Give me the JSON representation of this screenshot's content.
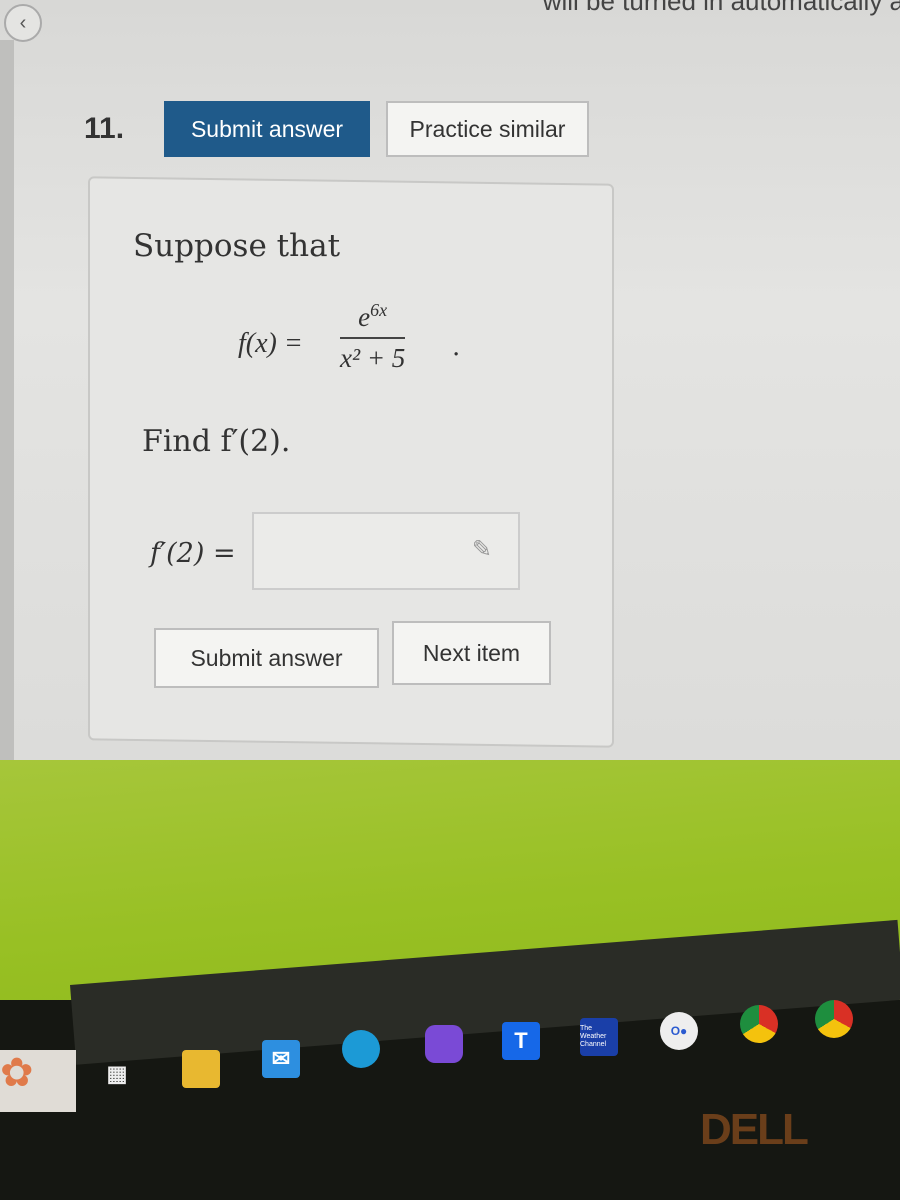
{
  "header": {
    "partial_notice": "will be turned in automatically a",
    "back_icon": "chevron-left-icon"
  },
  "question": {
    "number": "11.",
    "submit_label": "Submit answer",
    "practice_label": "Practice similar",
    "intro": "Suppose that",
    "function_lhs": "f(x) =",
    "numerator": "e^{6x}",
    "numerator_base": "e",
    "numerator_exp": "6x",
    "denominator": "x² + 5",
    "period": ".",
    "prompt": "Find f′(2).",
    "answer_label": "f′(2) =",
    "answer_value": "",
    "submit_bottom_label": "Submit answer",
    "next_label": "Next item"
  },
  "taskbar": {
    "icons": [
      "flower-wallpaper-icon",
      "task-view-icon",
      "file-explorer-icon",
      "mail-icon",
      "edge-icon",
      "copilot-icon",
      "t-app-icon",
      "weather-channel-icon",
      "zoom-icon",
      "chrome-icon",
      "chrome-profile-icon"
    ],
    "weather_label": "The Weather Channel",
    "t_label": "T"
  },
  "bezel": {
    "brand": "DELL"
  }
}
